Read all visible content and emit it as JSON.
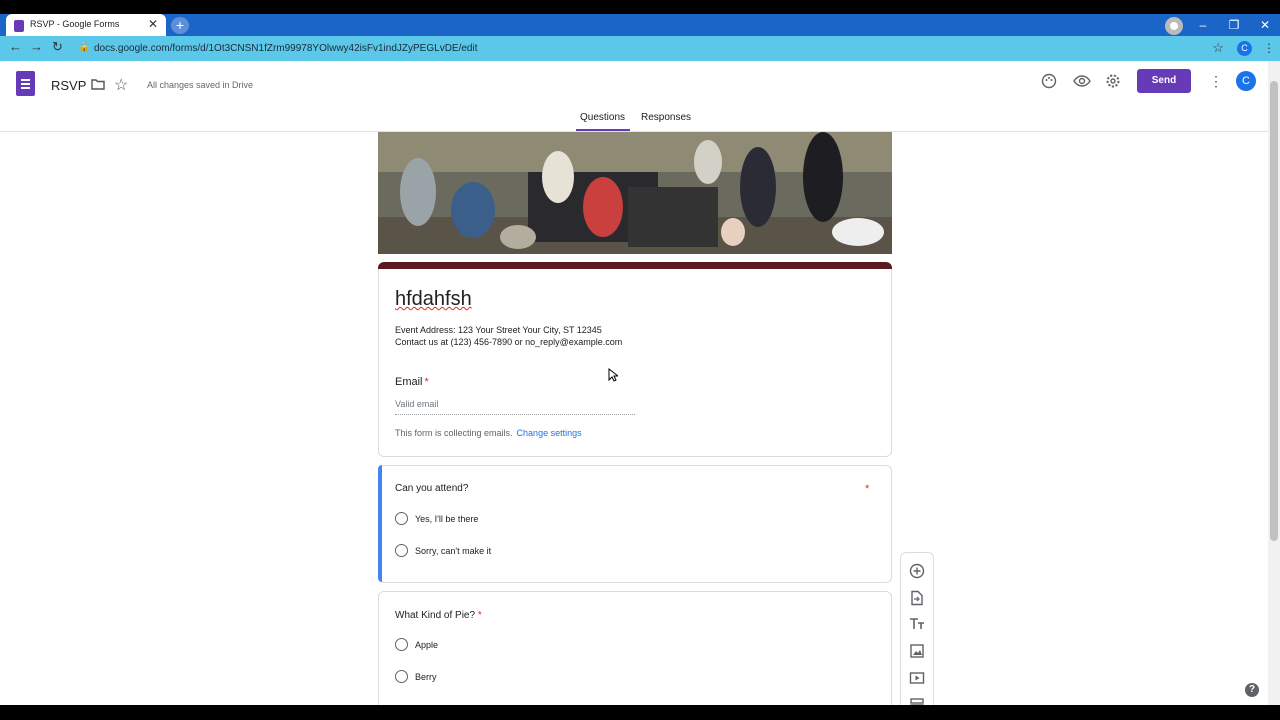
{
  "browser": {
    "tab_title": "RSVP - Google Forms",
    "tab_close": "✕",
    "new_tab": "+",
    "url": "docs.google.com/forms/d/1Ot3CNSN1fZrm99978YOlwwy42isFv1indJZyPEGLvDE/edit",
    "account_initial": "C",
    "window_buttons": [
      "–",
      "❐",
      "✕"
    ]
  },
  "app": {
    "doc_title": "RSVP",
    "saved_status": "All changes saved in Drive",
    "send_label": "Send",
    "account_initial": "C",
    "tabs": [
      {
        "label": "Questions",
        "active": true
      },
      {
        "label": "Responses",
        "active": false
      }
    ],
    "accent_color": "#673ab7"
  },
  "form": {
    "title": "hfdahfsh",
    "description_lines": [
      "Event Address: 123 Your Street Your City, ST 12345",
      "Contact us at (123) 456-7890 or no_reply@example.com"
    ],
    "email_label": "Email",
    "required_mark": "*",
    "email_placeholder": "Valid email",
    "collect_note": "This form is collecting emails.",
    "change_settings": "Change settings",
    "questions": [
      {
        "title": "Can you attend?",
        "required": "*",
        "options": [
          "Yes,  I'll be there",
          "Sorry, can't make it"
        ]
      },
      {
        "title": "What Kind of Pie?",
        "required": "*",
        "options": [
          "Apple",
          "Berry"
        ]
      }
    ]
  },
  "toolbar": {
    "icons": [
      "add-question-icon",
      "import-questions-icon",
      "add-title-icon",
      "add-image-icon",
      "add-video-icon",
      "add-section-icon"
    ]
  },
  "help": "?"
}
